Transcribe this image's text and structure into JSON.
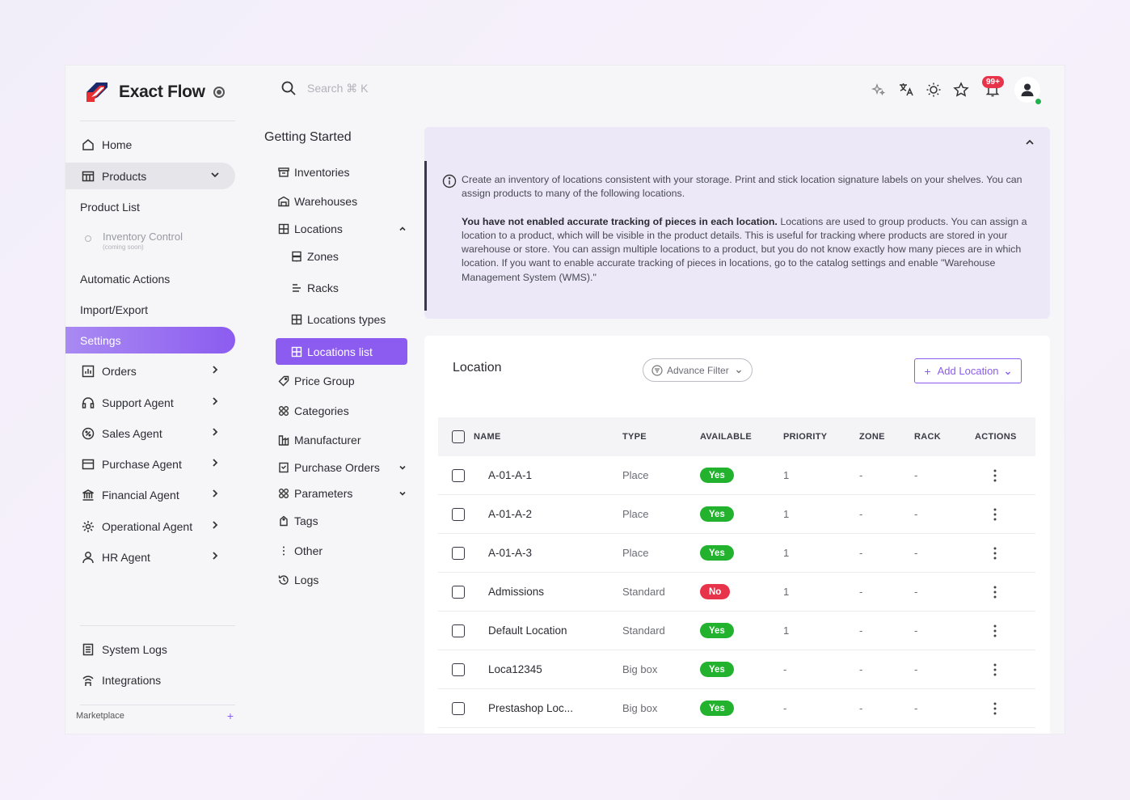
{
  "brand": {
    "name": "Exact Flow"
  },
  "search": {
    "placeholder": "Search ⌘ K"
  },
  "topbar": {
    "notification_count": "99+"
  },
  "sidebar": {
    "home": "Home",
    "products": "Products",
    "product_list": "Product List",
    "inventory_control": "Inventory Control",
    "inventory_note": "(coming soon)",
    "automatic_actions": "Automatic Actions",
    "import_export": "Import/Export",
    "settings": "Settings",
    "orders": "Orders",
    "support_agent": "Support Agent",
    "sales_agent": "Sales Agent",
    "purchase_agent": "Purchase Agent",
    "financial_agent": "Financial Agent",
    "operational_agent": "Operational Agent",
    "hr_agent": "HR Agent",
    "system_logs": "System Logs",
    "integrations": "Integrations",
    "marketplace": "Marketplace"
  },
  "submenu": {
    "title": "Getting Started",
    "inventories": "Inventories",
    "warehouses": "Warehouses",
    "locations": "Locations",
    "zones": "Zones",
    "racks": "Racks",
    "locations_types": "Locations types",
    "locations_list": "Locations list",
    "price_group": "Price Group",
    "categories": "Categories",
    "manufacturer": "Manufacturer",
    "purchase_orders": "Purchase Orders",
    "parameters": "Parameters",
    "tags": "Tags",
    "other": "Other",
    "logs": "Logs"
  },
  "info": {
    "line1": "Create an inventory of locations consistent with your storage. Print and stick location signature labels on your shelves. You can assign products to many of the following locations.",
    "bold": "You have not enabled accurate tracking of pieces in each location.",
    "line2": " Locations are used to group products. You can assign a location to a product, which will be visible in the product details. This is useful for tracking where products are stored in your warehouse or store. You can assign multiple locations to a product, but you do not know exactly how many pieces are in which location. If you want to enable accurate tracking of pieces in locations, go to the catalog settings and enable \"Warehouse Management System (WMS).\""
  },
  "location_card": {
    "title": "Location",
    "advance_filter": "Advance Filter",
    "add_location": "Add Location"
  },
  "table": {
    "headers": {
      "name": "NAME",
      "type": "TYPE",
      "available": "AVAILABLE",
      "priority": "PRIORITY",
      "zone": "ZONE",
      "rack": "RACK",
      "actions": "ACTIONS"
    },
    "rows": [
      {
        "name": "A-01-A-1",
        "type": "Place",
        "available": "Yes",
        "priority": "1",
        "zone": "-",
        "rack": "-"
      },
      {
        "name": "A-01-A-2",
        "type": "Place",
        "available": "Yes",
        "priority": "1",
        "zone": "-",
        "rack": "-"
      },
      {
        "name": "A-01-A-3",
        "type": "Place",
        "available": "Yes",
        "priority": "1",
        "zone": "-",
        "rack": "-"
      },
      {
        "name": "Admissions",
        "type": "Standard",
        "available": "No",
        "priority": "1",
        "zone": "-",
        "rack": "-"
      },
      {
        "name": "Default Location",
        "type": "Standard",
        "available": "Yes",
        "priority": "1",
        "zone": "-",
        "rack": "-"
      },
      {
        "name": "Loca12345",
        "type": "Big box",
        "available": "Yes",
        "priority": "-",
        "zone": "-",
        "rack": "-"
      },
      {
        "name": "Prestashop Loc...",
        "type": "Big box",
        "available": "Yes",
        "priority": "-",
        "zone": "-",
        "rack": "-"
      }
    ]
  },
  "colors": {
    "accent": "#8c5cf0",
    "yes": "#22b22e",
    "no": "#e8344a"
  }
}
